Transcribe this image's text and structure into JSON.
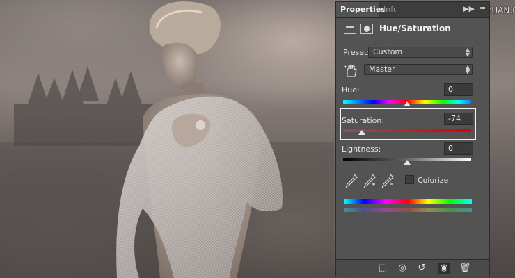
{
  "panel": {
    "tabs": [
      {
        "label": "Properties",
        "active": true
      },
      {
        "label": "Info",
        "active": false
      }
    ],
    "tab_controls": {
      "collapse": "▶▶",
      "menu": "≡"
    },
    "title": "Hue/Saturation",
    "preset": {
      "label": "Preset:",
      "value": "Custom"
    },
    "channel": {
      "value": "Master"
    },
    "hue": {
      "label": "Hue:",
      "value": "0"
    },
    "saturation": {
      "label": "Saturation:",
      "value": "-74"
    },
    "lightness": {
      "label": "Lightness:",
      "value": "0"
    },
    "colorize": {
      "label": "Colorize",
      "checked": false
    }
  },
  "watermark": "思缘设计论坛 www.MISSYUAN.COM",
  "footer_icons": [
    "clip-to-layer-icon",
    "view-previous-icon",
    "reset-icon",
    "visibility-eye-icon",
    "delete-icon"
  ],
  "colors": {
    "panel_bg": "#535353",
    "tab_bg": "#3d3d3d",
    "highlight": "#f4f4f4"
  }
}
